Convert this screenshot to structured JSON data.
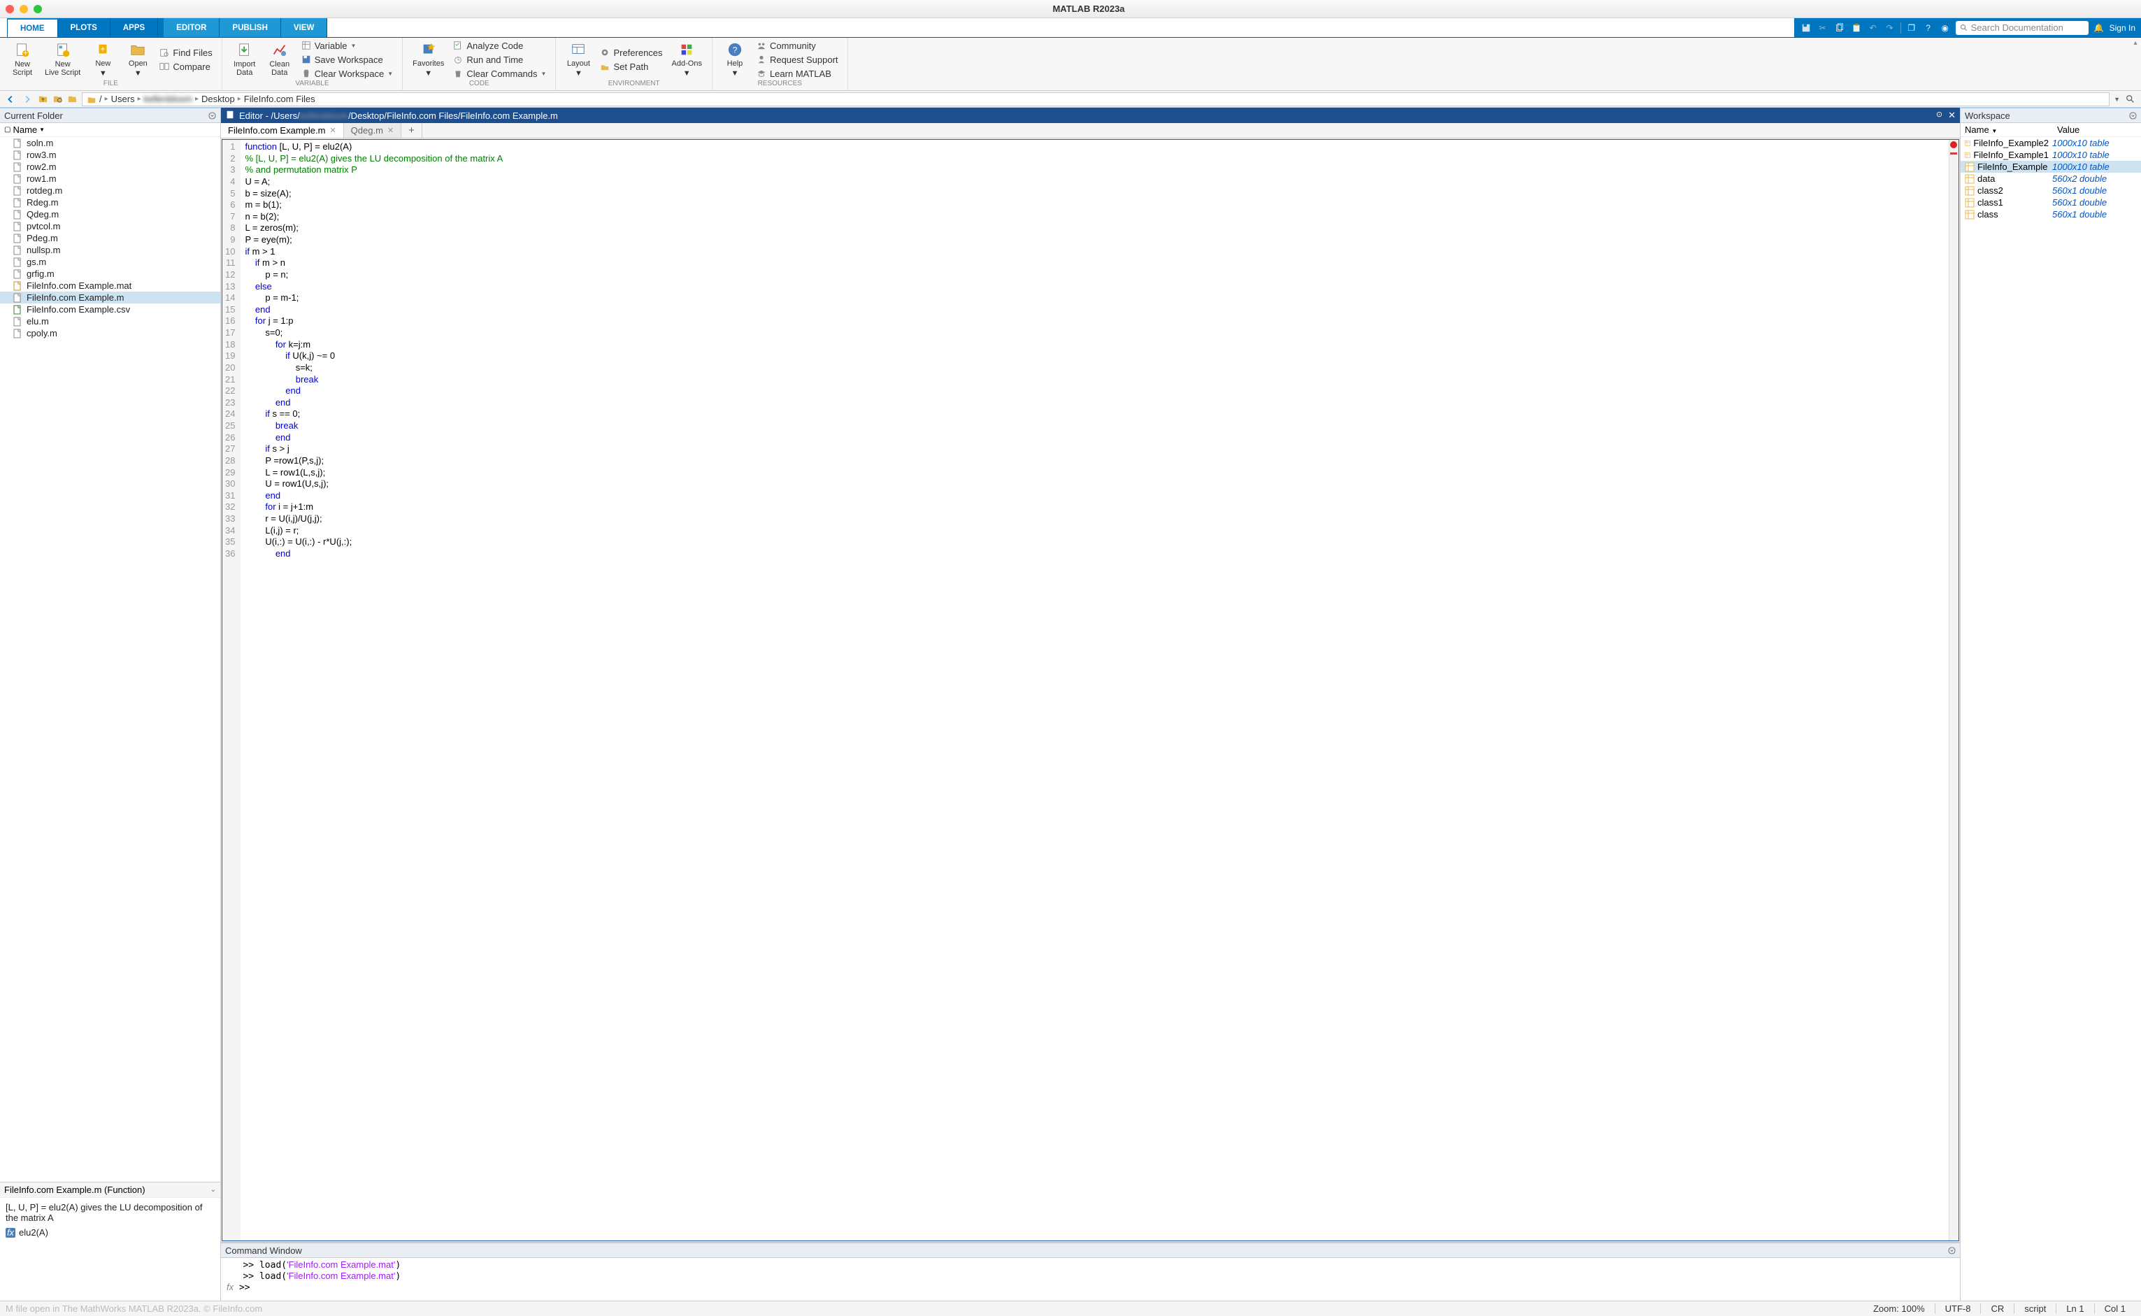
{
  "window_title": "MATLAB R2023a",
  "main_tabs": {
    "home": "HOME",
    "plots": "PLOTS",
    "apps": "APPS",
    "editor": "EDITOR",
    "publish": "PUBLISH",
    "view": "VIEW"
  },
  "search_placeholder": "Search Documentation",
  "signin": "Sign In",
  "toolstrip": {
    "new_script": "New\nScript",
    "new_live": "New\nLive Script",
    "new": "New",
    "open": "Open",
    "find_files": "Find Files",
    "compare": "Compare",
    "import_data": "Import\nData",
    "clean_data": "Clean\nData",
    "variable": "Variable",
    "save_ws": "Save Workspace",
    "clear_ws": "Clear Workspace",
    "favorites": "Favorites",
    "analyze": "Analyze Code",
    "run_time": "Run and Time",
    "clear_cmd": "Clear Commands",
    "layout": "Layout",
    "preferences": "Preferences",
    "set_path": "Set Path",
    "addons": "Add-Ons",
    "help": "Help",
    "community": "Community",
    "request": "Request Support",
    "learn": "Learn MATLAB",
    "sec_file": "FILE",
    "sec_variable": "VARIABLE",
    "sec_code": "CODE",
    "sec_env": "ENVIRONMENT",
    "sec_res": "RESOURCES"
  },
  "path": {
    "users": "Users",
    "redacted": "kellenbloom",
    "desktop": "Desktop",
    "folder": "FileInfo.com Files"
  },
  "current_folder": {
    "title": "Current Folder",
    "name_col": "Name",
    "files": [
      "soln.m",
      "row3.m",
      "row2.m",
      "row1.m",
      "rotdeg.m",
      "Rdeg.m",
      "Qdeg.m",
      "pvtcol.m",
      "Pdeg.m",
      "nullsp.m",
      "gs.m",
      "grfig.m",
      "FileInfo.com Example.mat",
      "FileInfo.com Example.m",
      "FileInfo.com Example.csv",
      "elu.m",
      "cpoly.m"
    ],
    "selected": "FileInfo.com Example.m",
    "detail_header": "FileInfo.com Example.m  (Function)",
    "detail_text": "[L, U, P] = elu2(A) gives the LU decomposition of the matrix A",
    "detail_func": "elu2(A)"
  },
  "editor": {
    "title": "Editor - /Users/……/Desktop/FileInfo.com Files/FileInfo.com Example.m",
    "title_pre": "Editor - /Users/",
    "title_post": "/Desktop/FileInfo.com Files/FileInfo.com Example.m",
    "title_redacted": "kellenbloom",
    "tabs": {
      "t1": "FileInfo.com Example.m",
      "t2": "Qdeg.m"
    },
    "line_count": 36,
    "code_lines": [
      {
        "t": "function ",
        "k": "kw",
        "r": "[L, U, P] = elu2(A)"
      },
      {
        "c": "% [L, U, P] = elu2(A) gives the LU decomposition of the matrix A"
      },
      {
        "c": "% and permutation matrix P"
      },
      {
        "p": "U = A;"
      },
      {
        "p": "b = size(A);"
      },
      {
        "p": "m = b(1);"
      },
      {
        "p": "n = b(2);"
      },
      {
        "p": "L = zeros(m);"
      },
      {
        "p": "P = eye(m);"
      },
      {
        "kw": "if ",
        "r": "m > 1"
      },
      {
        "i": 1,
        "kw": "if ",
        "r": "m > n"
      },
      {
        "i": 2,
        "p": "p = n;"
      },
      {
        "i": 1,
        "kw": "else"
      },
      {
        "i": 2,
        "p": "p = m-1;"
      },
      {
        "i": 1,
        "kw": "end"
      },
      {
        "i": 1,
        "kw": "for ",
        "r": "j = 1:p"
      },
      {
        "i": 2,
        "p": "s=0;"
      },
      {
        "i": 3,
        "kw": "for ",
        "r": "k=j:m"
      },
      {
        "i": 4,
        "kw": "if ",
        "r": "U(k,j) ~= 0"
      },
      {
        "i": 5,
        "p": "s=k;"
      },
      {
        "i": 5,
        "kw": "break"
      },
      {
        "i": 4,
        "kw": "end"
      },
      {
        "i": 3,
        "kw": "end"
      },
      {
        "i": 2,
        "kw": "if ",
        "r": "s == 0;"
      },
      {
        "i": 3,
        "kw": "break"
      },
      {
        "i": 3,
        "kw": "end"
      },
      {
        "i": 2,
        "kw": "if ",
        "r": "s > j"
      },
      {
        "i": 2,
        "p": "P =row1(P,s,j);"
      },
      {
        "i": 2,
        "p": "L = row1(L,s,j);"
      },
      {
        "i": 2,
        "p": "U = row1(U,s,j);"
      },
      {
        "i": 2,
        "kw": "end"
      },
      {
        "i": 2,
        "kw": "for ",
        "r": "i = j+1:m"
      },
      {
        "i": 2,
        "p": "r = U(i,j)/U(j,j);"
      },
      {
        "i": 2,
        "p": "L(i,j) = r;"
      },
      {
        "i": 2,
        "p": "U(i,:) = U(i,:) - r*U(j,:);"
      },
      {
        "i": 3,
        "kw": "end"
      }
    ]
  },
  "command_window": {
    "title": "Command Window",
    "lines": [
      ">> load('FileInfo.com Example.mat')",
      ">> load('FileInfo.com Example.mat')"
    ],
    "prompt": ">> "
  },
  "workspace": {
    "title": "Workspace",
    "cols": {
      "name": "Name",
      "value": "Value"
    },
    "vars": [
      {
        "n": "FileInfo_Example2",
        "v": "1000x10 table",
        "t": "table"
      },
      {
        "n": "FileInfo_Example1",
        "v": "1000x10 table",
        "t": "table"
      },
      {
        "n": "FileInfo_Example",
        "v": "1000x10 table",
        "t": "table",
        "sel": true
      },
      {
        "n": "data",
        "v": "560x2 double",
        "t": "double"
      },
      {
        "n": "class2",
        "v": "560x1 double",
        "t": "double"
      },
      {
        "n": "class1",
        "v": "560x1 double",
        "t": "double"
      },
      {
        "n": "class",
        "v": "560x1 double",
        "t": "double"
      }
    ]
  },
  "statusbar": {
    "watermark": "M file open in The MathWorks MATLAB R2023a. © FileInfo.com",
    "zoom": "Zoom: 100%",
    "enc": "UTF-8",
    "eol": "CR",
    "mode": "script",
    "pos": "Ln  1",
    "col": "Col  1"
  }
}
